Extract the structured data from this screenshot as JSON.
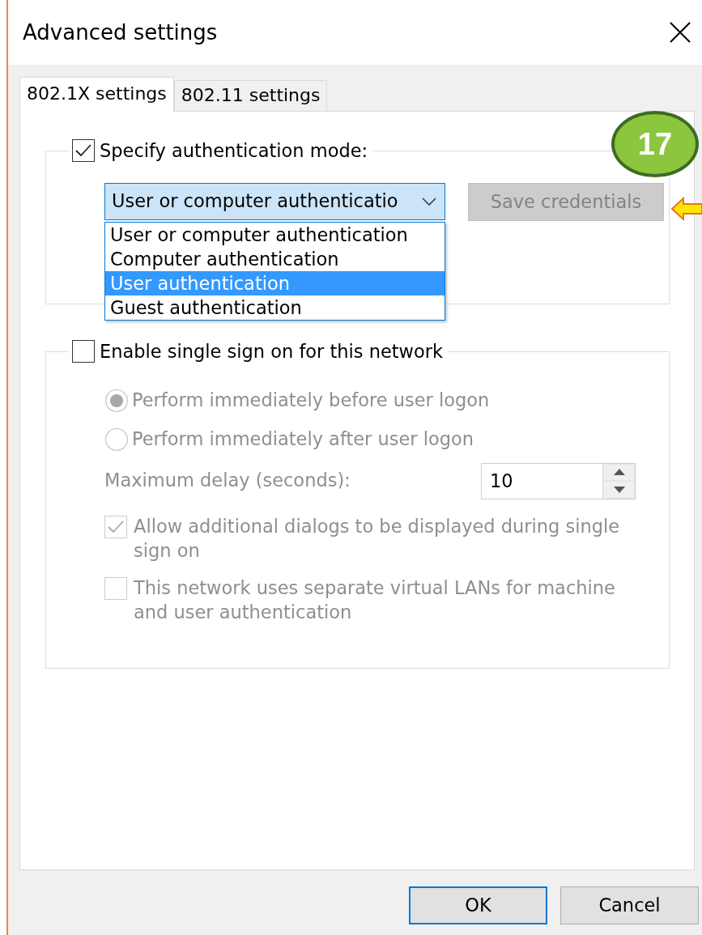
{
  "window": {
    "title": "Advanced settings"
  },
  "tabs": [
    {
      "label": "802.1X settings",
      "selected": true
    },
    {
      "label": "802.11 settings",
      "selected": false
    }
  ],
  "auth_group": {
    "label": "Specify authentication mode:",
    "checked": true,
    "combo": {
      "value": "User or computer authenticatio",
      "expanded": true,
      "options": [
        {
          "label": "User or computer authentication",
          "selected": false
        },
        {
          "label": "Computer authentication",
          "selected": false
        },
        {
          "label": "User authentication",
          "selected": true
        },
        {
          "label": "Guest authentication",
          "selected": false
        }
      ]
    },
    "save_button": {
      "label": "Save credentials",
      "disabled": true
    }
  },
  "sso_group": {
    "label": "Enable single sign on for this network",
    "checked": false,
    "items": [
      {
        "kind": "radio",
        "label": "Perform immediately before user logon",
        "selected": true,
        "disabled": true
      },
      {
        "kind": "radio",
        "label": "Perform immediately after user logon",
        "selected": false,
        "disabled": true
      },
      {
        "kind": "spin",
        "label": "Maximum delay (seconds):",
        "value": "10",
        "disabled": true
      },
      {
        "kind": "checkbox",
        "label": "Allow additional dialogs to be displayed during single sign on",
        "checked": true,
        "disabled": true
      },
      {
        "kind": "checkbox",
        "label": "This network uses separate virtual LANs for machine and user authentication",
        "checked": false,
        "disabled": true
      }
    ]
  },
  "buttons": [
    {
      "label": "OK",
      "default": true
    },
    {
      "label": "Cancel",
      "default": false
    }
  ],
  "annotation": {
    "step": "17"
  }
}
